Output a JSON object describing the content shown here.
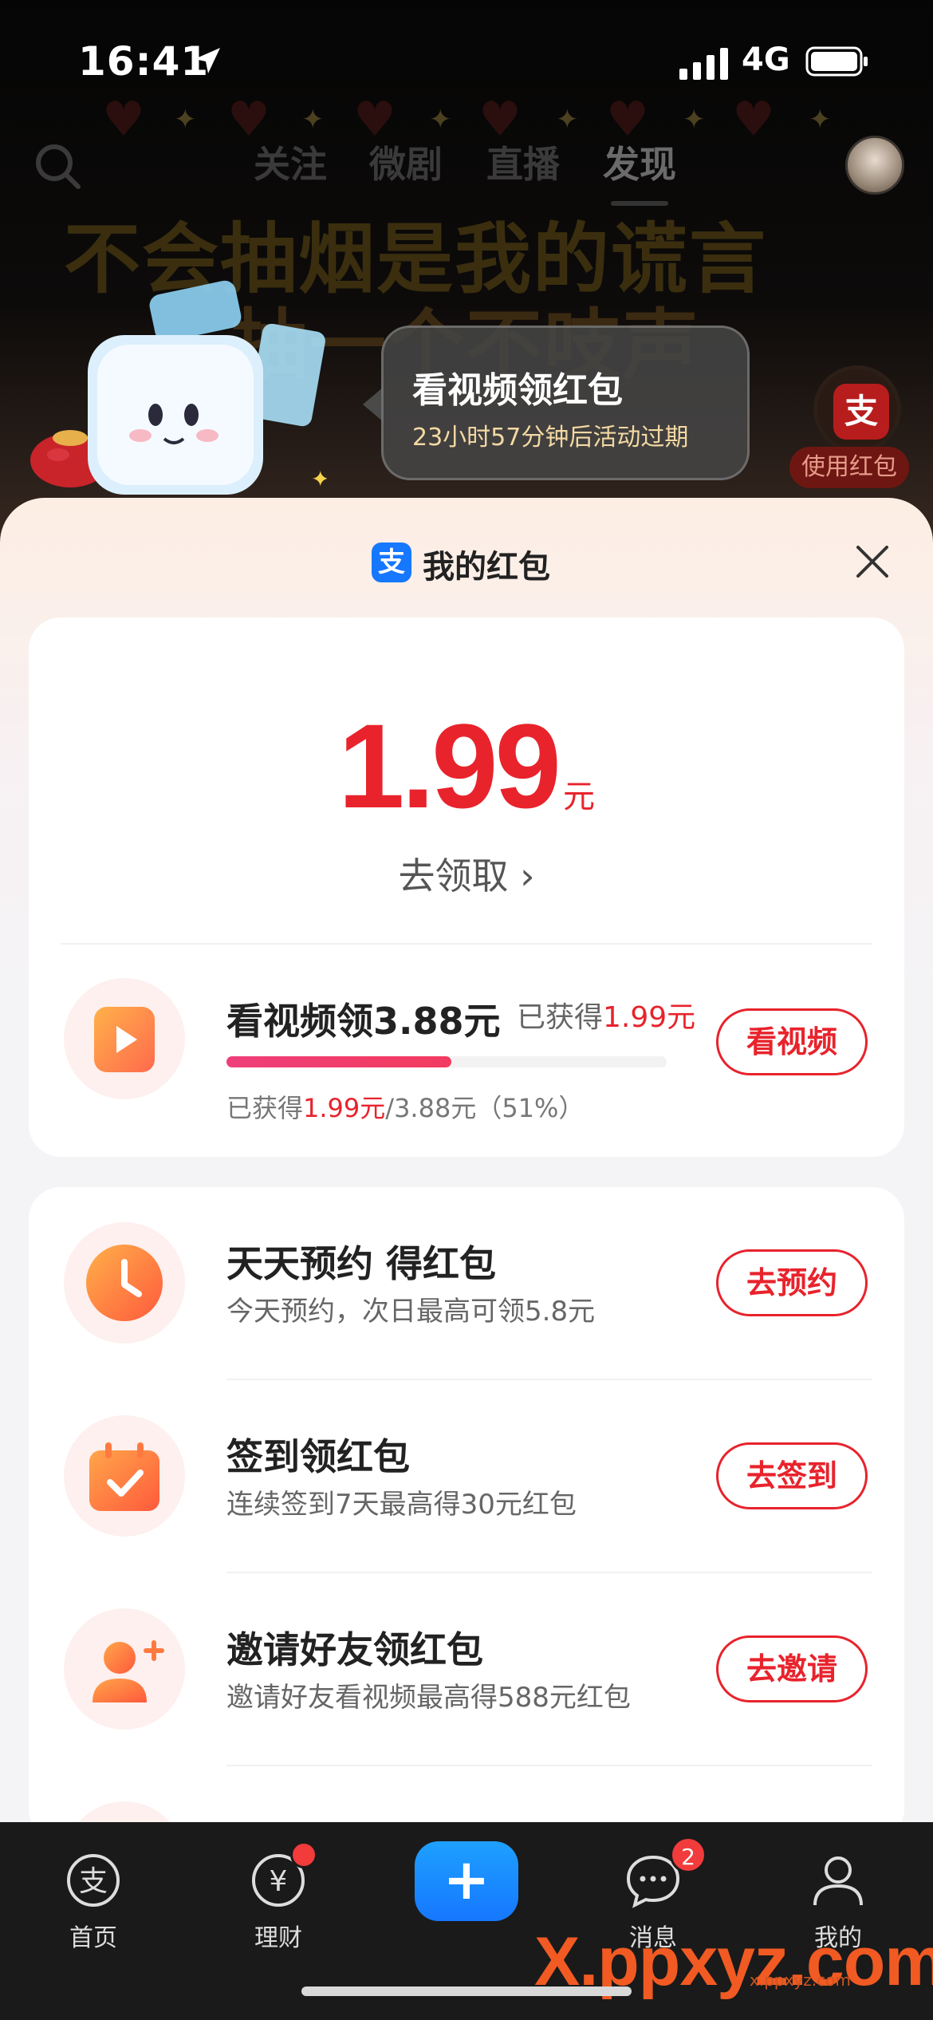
{
  "status_bar": {
    "time": "16:41",
    "network": "4G"
  },
  "top_nav": {
    "tabs": [
      {
        "label": "关注",
        "active": false
      },
      {
        "label": "微剧",
        "active": false
      },
      {
        "label": "直播",
        "active": false
      },
      {
        "label": "发现",
        "active": true
      }
    ]
  },
  "background_caption": {
    "line1": "不会抽烟是我的谎言",
    "line2": "抽一个不吱声"
  },
  "promo_bubble": {
    "title": "看视频领红包",
    "subtitle": "23小时57分钟后活动过期"
  },
  "side_redpack": {
    "glyph": "支",
    "label": "使用红包"
  },
  "sheet": {
    "title": "我的红包",
    "logo_glyph": "支",
    "accent_color": "#e8232c",
    "brand_color": "#1677ff"
  },
  "balance": {
    "amount": "1.99",
    "unit": "元",
    "claim_label": "去领取 ›"
  },
  "video_task": {
    "title": "看视频领3.88元",
    "earned_prefix": "已获得",
    "earned_amount": "1.99元",
    "progress_prefix": "已获得",
    "progress_earned": "1.99元",
    "progress_suffix": "/3.88元（51%）",
    "progress_fraction": 0.51,
    "button": "看视频"
  },
  "tasks": [
    {
      "icon": "clock-icon",
      "title": "天天预约 得红包",
      "desc": "今天预约，次日最高可领5.8元",
      "button": "去预约"
    },
    {
      "icon": "calendar-check-icon",
      "title": "签到领红包",
      "desc": "连续签到7天最高得30元红包",
      "button": "去签到"
    },
    {
      "icon": "add-friend-icon",
      "title": "邀请好友领红包",
      "desc": "邀请好友看视频最高得588元红包",
      "button": "去邀请"
    }
  ],
  "tab_bar": {
    "items": [
      {
        "label": "首页",
        "icon": "alipay-home-icon"
      },
      {
        "label": "理财",
        "icon": "wealth-icon",
        "dot": true
      },
      {
        "label": "+",
        "icon": "plus-icon"
      },
      {
        "label": "消息",
        "icon": "message-icon",
        "badge": "2"
      },
      {
        "label": "我的",
        "icon": "profile-icon"
      }
    ]
  },
  "watermark": {
    "text": "X.ppxyz.com",
    "small": "x.ppxyz.com"
  }
}
